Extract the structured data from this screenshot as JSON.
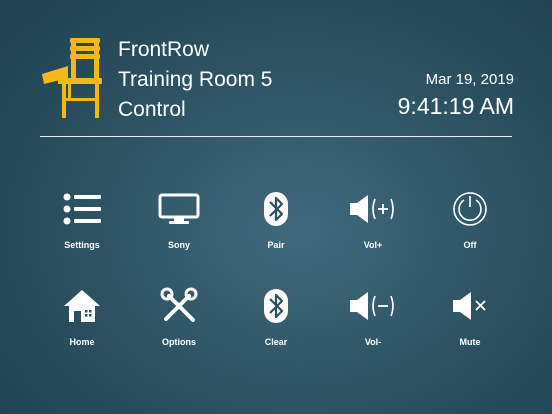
{
  "header": {
    "title_lines": [
      "FrontRow",
      "Training Room 5",
      "Control"
    ],
    "date": "Mar 19, 2019",
    "time": "9:41:19 AM"
  },
  "colors": {
    "logo": "#f5b819",
    "text": "#ffffff",
    "background_center": "#3f6a7c",
    "background_edge": "#173746"
  },
  "controls": [
    {
      "label": "Settings",
      "icon": "list-icon"
    },
    {
      "label": "Sony",
      "icon": "monitor-icon"
    },
    {
      "label": "Pair",
      "icon": "bluetooth-icon"
    },
    {
      "label": "Vol+",
      "icon": "volume-up-icon"
    },
    {
      "label": "Off",
      "icon": "power-icon"
    },
    {
      "label": "Home",
      "icon": "home-icon"
    },
    {
      "label": "Options",
      "icon": "tools-icon"
    },
    {
      "label": "Clear",
      "icon": "bluetooth-icon"
    },
    {
      "label": "Vol-",
      "icon": "volume-down-icon"
    },
    {
      "label": "Mute",
      "icon": "mute-icon"
    }
  ]
}
